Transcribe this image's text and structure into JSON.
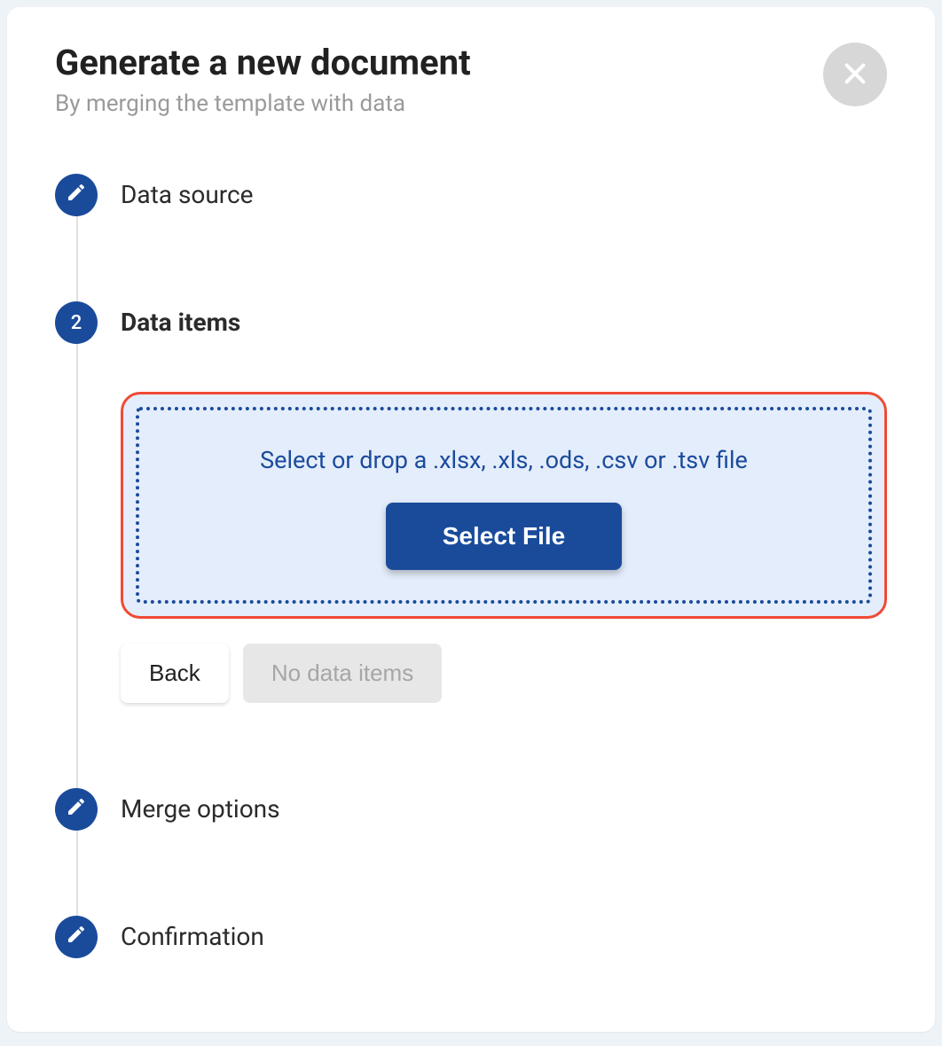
{
  "header": {
    "title": "Generate a new document",
    "subtitle": "By merging the template with data"
  },
  "steps": [
    {
      "type": "icon",
      "label": "Data source"
    },
    {
      "type": "number",
      "number": "2",
      "label": "Data items",
      "active": true
    },
    {
      "type": "icon",
      "label": "Merge options"
    },
    {
      "type": "icon",
      "label": "Confirmation"
    }
  ],
  "dropzone": {
    "text": "Select or drop a .xlsx, .xls, .ods, .csv or .tsv file",
    "button": "Select File"
  },
  "actions": {
    "back": "Back",
    "next_disabled": "No data items"
  }
}
